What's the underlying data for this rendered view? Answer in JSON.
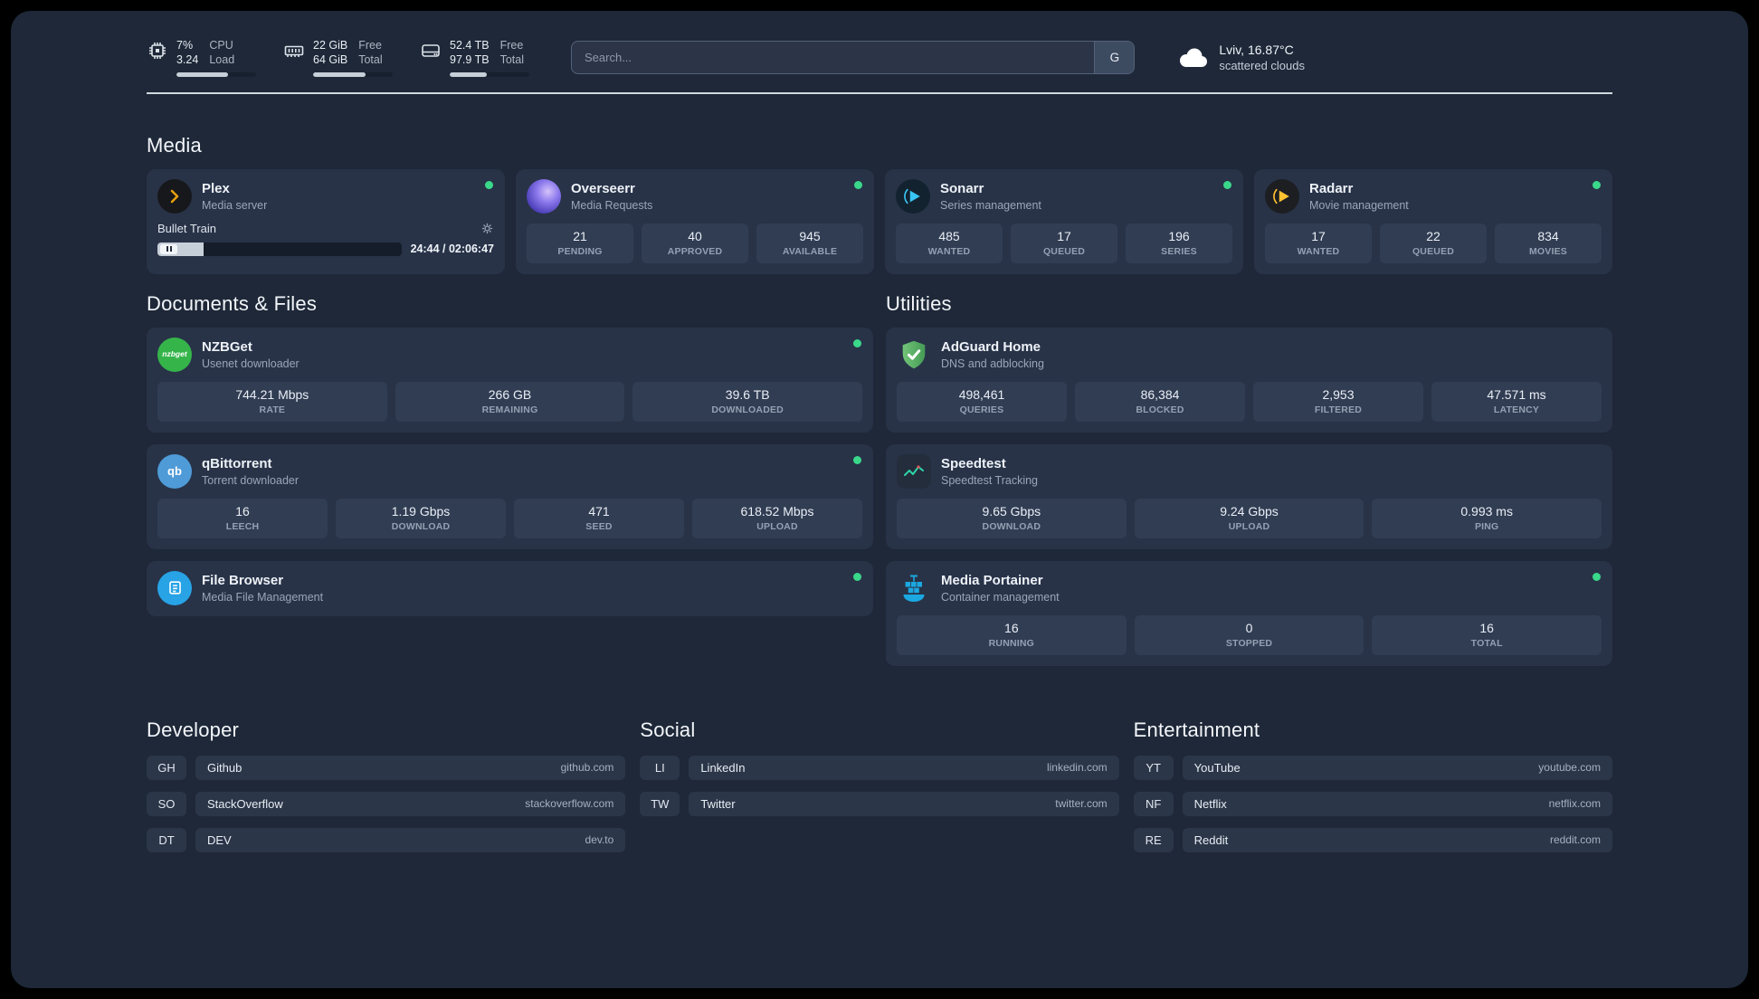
{
  "topbar": {
    "cpu": {
      "line1": "7%",
      "line2": "3.24",
      "label1": "CPU",
      "label2": "Load",
      "percent": 65
    },
    "ram": {
      "line1": "22 GiB",
      "line2": "64 GiB",
      "label1": "Free",
      "label2": "Total",
      "percent": 66
    },
    "disk": {
      "line1": "52.4 TB",
      "line2": "97.9 TB",
      "label1": "Free",
      "label2": "Total",
      "percent": 47
    },
    "search": {
      "placeholder": "Search...",
      "button_label": "G"
    },
    "weather": {
      "location": "Lviv, 16.87°C",
      "condition": "scattered clouds"
    }
  },
  "sections": {
    "media": {
      "heading": "Media",
      "plex": {
        "name": "Plex",
        "subtitle": "Media server",
        "now_playing": "Bullet Train",
        "time": "24:44 / 02:06:47",
        "progress_percent": 19
      },
      "overseerr": {
        "name": "Overseerr",
        "subtitle": "Media Requests",
        "stats": [
          {
            "value": "21",
            "label": "PENDING"
          },
          {
            "value": "40",
            "label": "APPROVED"
          },
          {
            "value": "945",
            "label": "AVAILABLE"
          }
        ]
      },
      "sonarr": {
        "name": "Sonarr",
        "subtitle": "Series management",
        "stats": [
          {
            "value": "485",
            "label": "WANTED"
          },
          {
            "value": "17",
            "label": "QUEUED"
          },
          {
            "value": "196",
            "label": "SERIES"
          }
        ]
      },
      "radarr": {
        "name": "Radarr",
        "subtitle": "Movie management",
        "stats": [
          {
            "value": "17",
            "label": "WANTED"
          },
          {
            "value": "22",
            "label": "QUEUED"
          },
          {
            "value": "834",
            "label": "MOVIES"
          }
        ]
      }
    },
    "documents": {
      "heading": "Documents & Files",
      "nzbget": {
        "name": "NZBGet",
        "subtitle": "Usenet downloader",
        "icon_text": "nzbget",
        "stats": [
          {
            "value": "744.21 Mbps",
            "label": "RATE"
          },
          {
            "value": "266 GB",
            "label": "REMAINING"
          },
          {
            "value": "39.6 TB",
            "label": "DOWNLOADED"
          }
        ]
      },
      "qbittorrent": {
        "name": "qBittorrent",
        "subtitle": "Torrent downloader",
        "icon_text": "qb",
        "stats": [
          {
            "value": "16",
            "label": "LEECH"
          },
          {
            "value": "1.19 Gbps",
            "label": "DOWNLOAD"
          },
          {
            "value": "471",
            "label": "SEED"
          },
          {
            "value": "618.52 Mbps",
            "label": "UPLOAD"
          }
        ]
      },
      "filebrowser": {
        "name": "File Browser",
        "subtitle": "Media File Management"
      }
    },
    "utilities": {
      "heading": "Utilities",
      "adguard": {
        "name": "AdGuard Home",
        "subtitle": "DNS and adblocking",
        "stats": [
          {
            "value": "498,461",
            "label": "QUERIES"
          },
          {
            "value": "86,384",
            "label": "BLOCKED"
          },
          {
            "value": "2,953",
            "label": "FILTERED"
          },
          {
            "value": "47.571 ms",
            "label": "LATENCY"
          }
        ]
      },
      "speedtest": {
        "name": "Speedtest",
        "subtitle": "Speedtest Tracking",
        "stats": [
          {
            "value": "9.65 Gbps",
            "label": "DOWNLOAD"
          },
          {
            "value": "9.24 Gbps",
            "label": "UPLOAD"
          },
          {
            "value": "0.993 ms",
            "label": "PING"
          }
        ]
      },
      "portainer": {
        "name": "Media Portainer",
        "subtitle": "Container management",
        "stats": [
          {
            "value": "16",
            "label": "RUNNING"
          },
          {
            "value": "0",
            "label": "STOPPED"
          },
          {
            "value": "16",
            "label": "TOTAL"
          }
        ]
      }
    }
  },
  "bookmarks": [
    {
      "heading": "Developer",
      "items": [
        {
          "abbr": "GH",
          "name": "Github",
          "url": "github.com"
        },
        {
          "abbr": "SO",
          "name": "StackOverflow",
          "url": "stackoverflow.com"
        },
        {
          "abbr": "DT",
          "name": "DEV",
          "url": "dev.to"
        }
      ]
    },
    {
      "heading": "Social",
      "items": [
        {
          "abbr": "LI",
          "name": "LinkedIn",
          "url": "linkedin.com"
        },
        {
          "abbr": "TW",
          "name": "Twitter",
          "url": "twitter.com"
        }
      ]
    },
    {
      "heading": "Entertainment",
      "items": [
        {
          "abbr": "YT",
          "name": "YouTube",
          "url": "youtube.com"
        },
        {
          "abbr": "NF",
          "name": "Netflix",
          "url": "netflix.com"
        },
        {
          "abbr": "RE",
          "name": "Reddit",
          "url": "reddit.com"
        }
      ]
    }
  ],
  "colors": {
    "status_green": "#3ad88a",
    "plex_gold": "#e5a00d",
    "sonarr_blue": "#38c6f4",
    "radarr_gold": "#ffc230",
    "nzbget_green": "#35b44a",
    "qbittorrent_blue": "#4f9bd8",
    "filebrowser_blue": "#27a3e6",
    "adguard_green": "#459b55",
    "portainer_blue": "#1ba8e0"
  }
}
